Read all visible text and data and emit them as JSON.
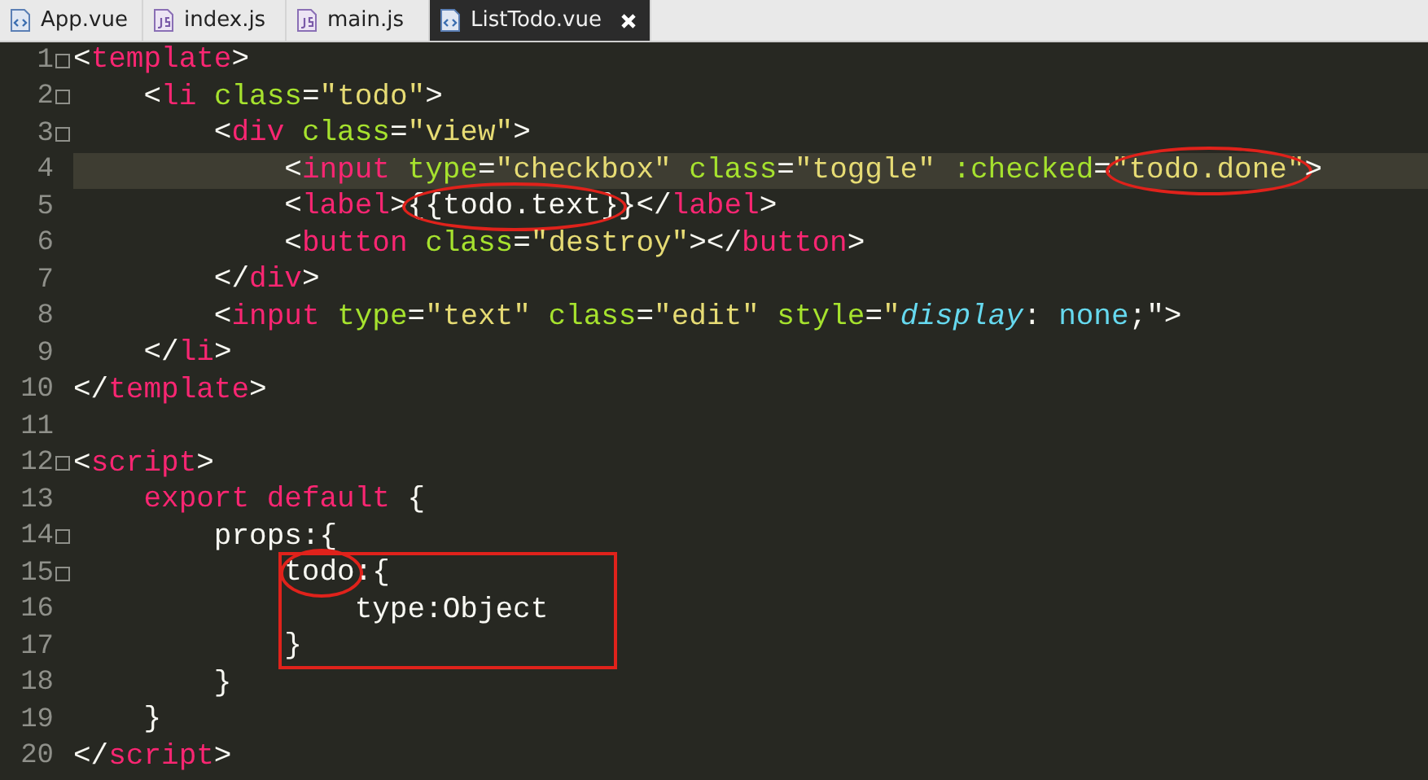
{
  "tabs": [
    {
      "label": "App.vue",
      "kind": "vue",
      "selected": false
    },
    {
      "label": "index.js",
      "kind": "js",
      "selected": false
    },
    {
      "label": "main.js",
      "kind": "js",
      "selected": false
    },
    {
      "label": "ListTodo.vue",
      "kind": "vue",
      "selected": true
    }
  ],
  "editor": {
    "lines": [
      {
        "number": "1",
        "fold": true,
        "current": false,
        "tokens": [
          {
            "kind": "p",
            "text": "<"
          },
          {
            "kind": "t",
            "text": "template"
          },
          {
            "kind": "p",
            "text": ">"
          }
        ]
      },
      {
        "number": "2",
        "fold": true,
        "current": false,
        "tokens": [
          {
            "kind": "p",
            "text": "    <"
          },
          {
            "kind": "t",
            "text": "li"
          },
          {
            "kind": "a",
            "text": " class"
          },
          {
            "kind": "p",
            "text": "="
          },
          {
            "kind": "s",
            "text": "\"todo\""
          },
          {
            "kind": "p",
            "text": ">"
          }
        ]
      },
      {
        "number": "3",
        "fold": true,
        "current": false,
        "tokens": [
          {
            "kind": "p",
            "text": "        <"
          },
          {
            "kind": "t",
            "text": "div"
          },
          {
            "kind": "a",
            "text": " class"
          },
          {
            "kind": "p",
            "text": "="
          },
          {
            "kind": "s",
            "text": "\"view\""
          },
          {
            "kind": "p",
            "text": ">"
          }
        ]
      },
      {
        "number": "4",
        "fold": false,
        "current": true,
        "tokens": [
          {
            "kind": "p",
            "text": "            <"
          },
          {
            "kind": "t",
            "text": "input"
          },
          {
            "kind": "a",
            "text": " type"
          },
          {
            "kind": "p",
            "text": "="
          },
          {
            "kind": "s",
            "text": "\"checkbox\""
          },
          {
            "kind": "a",
            "text": " class"
          },
          {
            "kind": "p",
            "text": "="
          },
          {
            "kind": "s",
            "text": "\"toggle\""
          },
          {
            "kind": "a",
            "text": " :checked"
          },
          {
            "kind": "p",
            "text": "="
          },
          {
            "kind": "s",
            "text": "\"todo.done\"",
            "circled": true
          },
          {
            "kind": "p",
            "text": ">"
          }
        ]
      },
      {
        "number": "5",
        "fold": false,
        "current": false,
        "tokens": [
          {
            "kind": "p",
            "text": "            <"
          },
          {
            "kind": "t",
            "text": "label"
          },
          {
            "kind": "p",
            "text": ">"
          },
          {
            "kind": "p",
            "text": "{{todo.text}",
            "circled": true
          },
          {
            "kind": "p",
            "text": "}</"
          },
          {
            "kind": "t",
            "text": "label"
          },
          {
            "kind": "p",
            "text": ">"
          }
        ]
      },
      {
        "number": "6",
        "fold": false,
        "current": false,
        "tokens": [
          {
            "kind": "p",
            "text": "            <"
          },
          {
            "kind": "t",
            "text": "button"
          },
          {
            "kind": "a",
            "text": " class"
          },
          {
            "kind": "p",
            "text": "="
          },
          {
            "kind": "s",
            "text": "\"destroy\""
          },
          {
            "kind": "p",
            "text": "></"
          },
          {
            "kind": "t",
            "text": "button"
          },
          {
            "kind": "p",
            "text": ">"
          }
        ]
      },
      {
        "number": "7",
        "fold": false,
        "current": false,
        "tokens": [
          {
            "kind": "p",
            "text": "        </"
          },
          {
            "kind": "t",
            "text": "div"
          },
          {
            "kind": "p",
            "text": ">"
          }
        ]
      },
      {
        "number": "8",
        "fold": false,
        "current": false,
        "tokens": [
          {
            "kind": "p",
            "text": "        <"
          },
          {
            "kind": "t",
            "text": "input"
          },
          {
            "kind": "a",
            "text": " type"
          },
          {
            "kind": "p",
            "text": "="
          },
          {
            "kind": "s",
            "text": "\"text\""
          },
          {
            "kind": "a",
            "text": " class"
          },
          {
            "kind": "p",
            "text": "="
          },
          {
            "kind": "s",
            "text": "\"edit\""
          },
          {
            "kind": "a",
            "text": " style"
          },
          {
            "kind": "p",
            "text": "="
          },
          {
            "kind": "s",
            "text": "\""
          },
          {
            "kind": "c",
            "text": "display"
          },
          {
            "kind": "p",
            "text": ":"
          },
          {
            "kind": "v",
            "text": " none"
          },
          {
            "kind": "p",
            "text": ";\">"
          }
        ]
      },
      {
        "number": "9",
        "fold": false,
        "current": false,
        "tokens": [
          {
            "kind": "p",
            "text": "    </"
          },
          {
            "kind": "t",
            "text": "li"
          },
          {
            "kind": "p",
            "text": ">"
          }
        ]
      },
      {
        "number": "10",
        "fold": false,
        "current": false,
        "tokens": [
          {
            "kind": "p",
            "text": "</"
          },
          {
            "kind": "t",
            "text": "template"
          },
          {
            "kind": "p",
            "text": ">"
          }
        ]
      },
      {
        "number": "11",
        "fold": false,
        "current": false
      },
      {
        "number": "12",
        "fold": true,
        "current": false,
        "tokens": [
          {
            "kind": "p",
            "text": "<"
          },
          {
            "kind": "t",
            "text": "script"
          },
          {
            "kind": "p",
            "text": ">"
          }
        ]
      },
      {
        "number": "13",
        "fold": false,
        "current": false,
        "tokens": [
          {
            "kind": "k",
            "text": "    export"
          },
          {
            "kind": "k",
            "text": " default"
          },
          {
            "kind": "p",
            "text": " {"
          }
        ]
      },
      {
        "number": "14",
        "fold": true,
        "current": false,
        "tokens": [
          {
            "kind": "p",
            "text": "        props:{"
          }
        ]
      },
      {
        "number": "15",
        "fold": true,
        "current": false,
        "tokens": [
          {
            "kind": "p",
            "text": "            todo",
            "circled": true,
            "boxed": true
          },
          {
            "kind": "p",
            "text": ":{"
          }
        ]
      },
      {
        "number": "16",
        "fold": false,
        "current": false,
        "tokens": [
          {
            "kind": "p",
            "text": "                type:Object"
          }
        ]
      },
      {
        "number": "17",
        "fold": false,
        "current": false,
        "tokens": [
          {
            "kind": "p",
            "text": "            }"
          }
        ]
      },
      {
        "number": "18",
        "fold": false,
        "current": false,
        "tokens": [
          {
            "kind": "p",
            "text": "        }"
          }
        ]
      },
      {
        "number": "19",
        "fold": false,
        "current": false,
        "tokens": [
          {
            "kind": "p",
            "text": "    }"
          }
        ]
      },
      {
        "number": "20",
        "fold": false,
        "current": false,
        "tokens": [
          {
            "kind": "p",
            "text": "</"
          },
          {
            "kind": "t",
            "text": "script"
          },
          {
            "kind": "p",
            "text": ">"
          }
        ]
      }
    ]
  }
}
